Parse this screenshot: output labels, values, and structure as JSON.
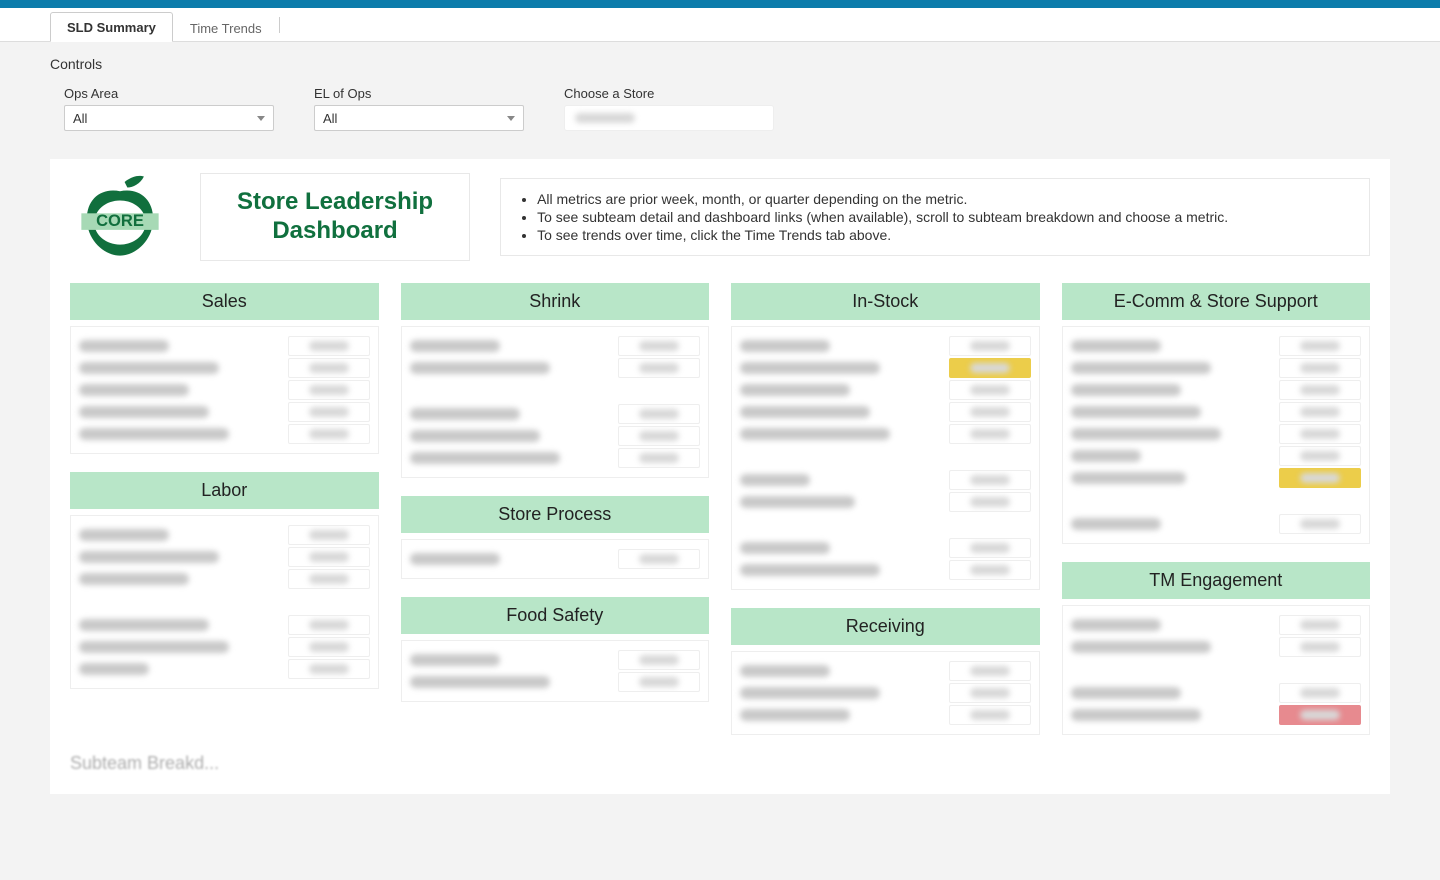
{
  "tabs": [
    {
      "label": "SLD Summary",
      "active": true
    },
    {
      "label": "Time Trends",
      "active": false
    }
  ],
  "controls": {
    "title": "Controls",
    "ops_area": {
      "label": "Ops Area",
      "value": "All"
    },
    "el_of_ops": {
      "label": "EL of Ops",
      "value": "All"
    },
    "choose_store": {
      "label": "Choose a Store",
      "value": ""
    }
  },
  "header": {
    "title_line1": "Store Leadership",
    "title_line2": "Dashboard",
    "logo_text": "CORE",
    "notes": [
      "All metrics are prior week, month, or quarter depending on the metric.",
      "To see subteam detail and dashboard links (when available), scroll to subteam breakdown and choose a metric.",
      "To see trends over time, click the Time Trends tab above."
    ]
  },
  "cards": {
    "sales": {
      "title": "Sales",
      "sections": [
        {
          "rows": 5
        }
      ]
    },
    "labor": {
      "title": "Labor",
      "sections": [
        {
          "rows": 3
        },
        {
          "rows": 3
        }
      ]
    },
    "shrink": {
      "title": "Shrink",
      "sections": [
        {
          "rows": 2
        },
        {
          "rows": 3
        }
      ]
    },
    "store_process": {
      "title": "Store Process",
      "sections": [
        {
          "rows": 1
        }
      ]
    },
    "food_safety": {
      "title": "Food Safety",
      "sections": [
        {
          "rows": 2
        }
      ]
    },
    "in_stock": {
      "title": "In-Stock",
      "sections": [
        {
          "rows": 5,
          "highlight_row": 1,
          "highlight": "yellow"
        },
        {
          "rows": 2
        },
        {
          "rows": 2
        }
      ]
    },
    "receiving": {
      "title": "Receiving",
      "sections": [
        {
          "rows": 3
        }
      ]
    },
    "ecomm": {
      "title": "E-Comm & Store Support",
      "sections": [
        {
          "rows": 7,
          "highlight_row": 6,
          "highlight": "yellow"
        },
        {
          "rows": 1
        }
      ]
    },
    "tm_engagement": {
      "title": "TM Engagement",
      "sections": [
        {
          "rows": 2
        },
        {
          "rows": 2,
          "highlight_row": 1,
          "highlight": "red"
        }
      ]
    }
  },
  "partial_section": "Subteam Breakd..."
}
